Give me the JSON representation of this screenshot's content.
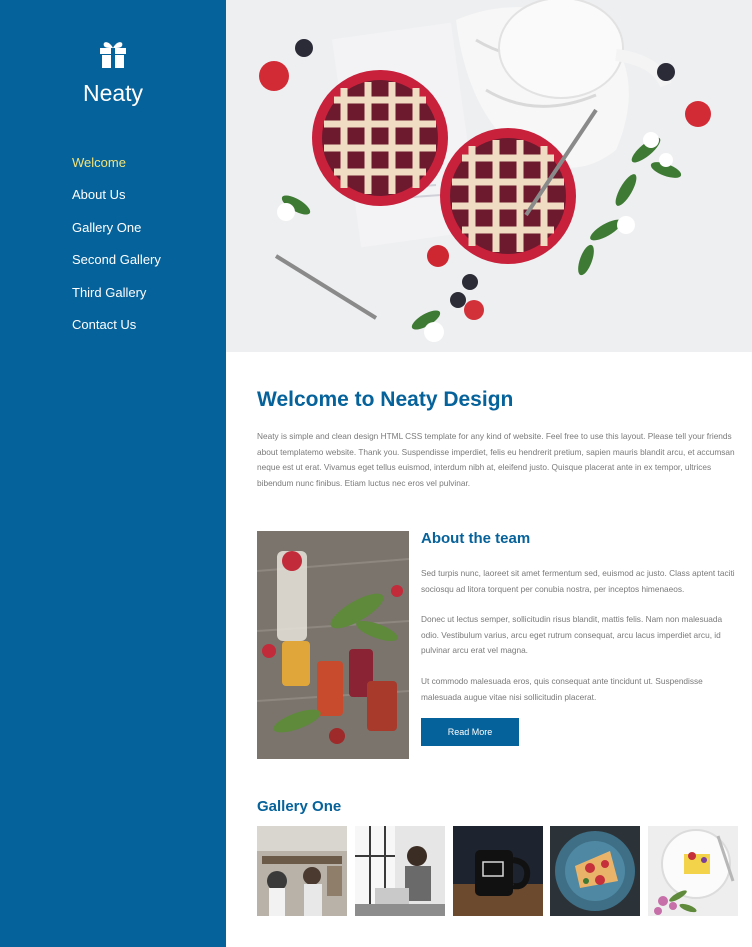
{
  "brand": {
    "name": "Neaty",
    "icon": "gift-icon"
  },
  "nav": {
    "items": [
      {
        "label": "Welcome",
        "active": true
      },
      {
        "label": "About Us",
        "active": false
      },
      {
        "label": "Gallery One",
        "active": false
      },
      {
        "label": "Second Gallery",
        "active": false
      },
      {
        "label": "Third Gallery",
        "active": false
      },
      {
        "label": "Contact Us",
        "active": false
      }
    ]
  },
  "welcome": {
    "title": "Welcome to Neaty Design",
    "text": "Neaty is simple and clean design HTML CSS template for any kind of website. Feel free to use this layout. Please tell your friends about templatemo website. Thank you. Suspendisse imperdiet, felis eu hendrerit pretium, sapien mauris blandit arcu, et accumsan neque est ut erat. Vivamus eget tellus euismod, interdum nibh at, eleifend justo. Quisque placerat ante in ex tempor, ultrices bibendum nunc finibus. Etiam luctus nec eros vel pulvinar."
  },
  "about": {
    "title": "About the team",
    "paragraphs": [
      "Sed turpis nunc, laoreet sit amet fermentum sed, euismod ac justo. Class aptent taciti sociosqu ad litora torquent per conubia nostra, per inceptos himenaeos.",
      "Donec ut lectus semper, sollicitudin risus blandit, mattis felis. Nam non malesuada odio. Vestibulum varius, arcu eget rutrum consequat, arcu lacus imperdiet arcu, id pulvinar arcu erat vel magna.",
      "Ut commodo malesuada eros, quis consequat ante tincidunt ut. Suspendisse malesuada augue vitae nisi sollicitudin placerat."
    ],
    "button_label": "Read More"
  },
  "gallery": {
    "title": "Gallery One",
    "thumbnails": [
      "cafe-interior",
      "woman-at-laptop",
      "black-mug",
      "pizza-plate",
      "dessert-plate"
    ]
  },
  "colors": {
    "primary": "#06629b",
    "nav_active": "#f2e37a",
    "body_text": "#7a7a7a"
  }
}
